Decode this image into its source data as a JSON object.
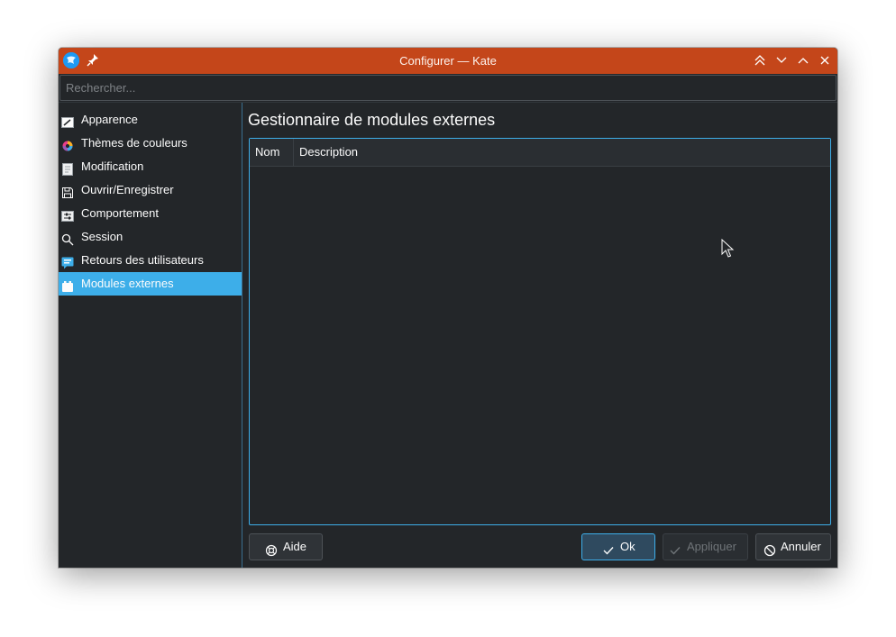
{
  "window": {
    "title": "Configurer — Kate"
  },
  "search": {
    "placeholder": "Rechercher..."
  },
  "sidebar": {
    "items": [
      {
        "label": "Apparence",
        "icon": "appearance-icon"
      },
      {
        "label": "Thèmes de couleurs",
        "icon": "color-themes-icon"
      },
      {
        "label": "Modification",
        "icon": "editing-icon"
      },
      {
        "label": "Ouvrir/Enregistrer",
        "icon": "save-icon"
      },
      {
        "label": "Comportement",
        "icon": "behavior-icon"
      },
      {
        "label": "Session",
        "icon": "search-icon"
      },
      {
        "label": "Retours des utilisateurs",
        "icon": "feedback-icon"
      },
      {
        "label": "Modules externes",
        "icon": "plugin-icon",
        "selected": true
      }
    ]
  },
  "main": {
    "title": "Gestionnaire de modules externes",
    "table": {
      "columns": [
        "Nom",
        "Description"
      ],
      "rows": []
    }
  },
  "buttons": {
    "help": "Aide",
    "ok": "Ok",
    "apply": "Appliquer",
    "cancel": "Annuler"
  },
  "colors": {
    "titlebar": "#c4461a",
    "accent": "#3daee9",
    "background": "#232629"
  }
}
